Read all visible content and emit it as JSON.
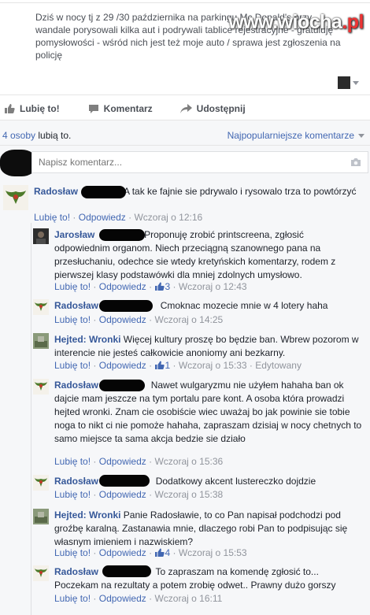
{
  "post": {
    "text": "Dziś w nocy tj z 29 /30 października na parkingu Mc Donald's przy... wandale porysowali kilka aut i podrywali tablice rejestracyjne - gratuluję pomysłowości - wśród nich jest też moje auto / sprawa jest zgłoszenia na policję",
    "watermark_main": "www.wiocha",
    "watermark_tld": ".pl"
  },
  "actions": {
    "like": "Lubię to!",
    "comment": "Komentarz",
    "share": "Udostępnij"
  },
  "stats": {
    "likes_count": "4 osoby",
    "likes_suffix": " lubią to.",
    "sort_label": "Najpopularniejsze komentarze"
  },
  "composer": {
    "placeholder": "Napisz komentarz..."
  },
  "labels": {
    "like": "Lubię to!",
    "reply": "Odpowiedz",
    "edited": "Edytowany"
  },
  "comments": [
    {
      "author": "Radosław",
      "text": "A tak ke fajnie sie pdrywalo i rysowalo trza to powtórzyć",
      "time": "Wczoraj o 12:16",
      "likes": ""
    },
    {
      "author": "Jarosław",
      "text": "Proponuję zrobić printscreena, zgłosić odpowiednim organom. Niech przeciągną szanownego pana na przesłuchaniu, odechce sie wtedy kretyńskich komentarzy, rodem z pierwszej klasy podstawówki dla mniej zdolnych umysłowo.",
      "time": "Wczoraj o 12:43",
      "likes": "3"
    },
    {
      "author": "Radosław",
      "text": "Cmoknac mozecie mnie w 4 lotery haha",
      "time": "Wczoraj o 14:25",
      "likes": ""
    },
    {
      "author": "Hejted: Wronki",
      "text": "Więcej kultury proszę bo będzie ban. Wbrew pozorom w interencie nie jesteś całkowicie anoniomy ani bezkarny.",
      "time": "Wczoraj o 15:33",
      "likes": "1"
    },
    {
      "author": "Radosław",
      "text": "Nawet wulgaryzmu nie użyłem hahaha ban ok dajcie mam jeszcze na tym portalu pare kont. A osoba która prowadzi hejted wronki. Znam cie osobiście wiec uważaj bo jak powinie sie tobie noga to nikt ci nie pomoże hahaha, zapraszam dzisiaj w nocy chetnych to samo miejsce ta sama akcja bedzie sie działo",
      "time": "Wczoraj o 15:36",
      "likes": ""
    },
    {
      "author": "Radosław",
      "text": "Dodatkowy akcent lustereczko dojdzie",
      "time": "Wczoraj o 15:38",
      "likes": ""
    },
    {
      "author": "Hejted: Wronki",
      "text": "Panie Radosławie, to co Pan napisał podchodzi pod groźbę karalną. Zastanawia mnie, dlaczego robi Pan to podpisując się własnym imieniem i nazwiskiem?",
      "time": "Wczoraj o 15:53",
      "likes": "4"
    },
    {
      "author": "Radosław",
      "text": "To zapraszam na komendę zgłosić to... Poczekam na rezultaty a potem zrobię odwet.. Prawny dużo gorszy",
      "time": "Wczoraj o 16:11",
      "likes": ""
    }
  ]
}
